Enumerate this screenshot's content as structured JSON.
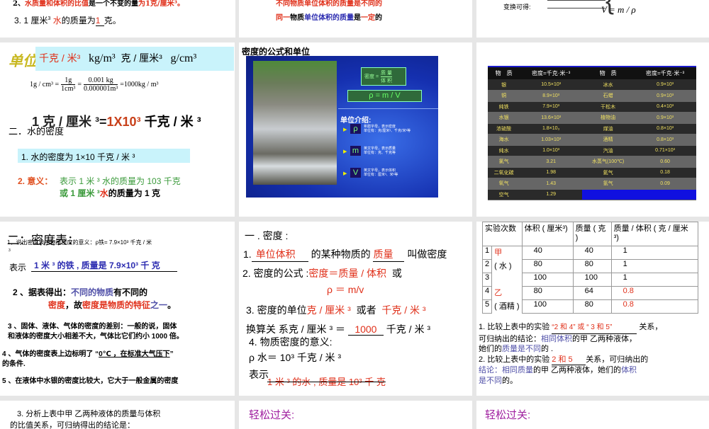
{
  "slide1": {
    "line2_prefix": "2、",
    "line2_red": "水质量和体积的比值",
    "line2_mid": "是一个不变的量",
    "line2_end": "为1克/厘米³。",
    "line3_a": "3. 1 厘米",
    "line3_sup": "3",
    "line3_water": "水",
    "line3_b": "的质量为",
    "line3_blank": "1",
    "line3_c": "克。"
  },
  "slide2": {
    "line1": "不同物质单位体积的质量是不同的",
    "line2_a": "同一",
    "line2_b": "物质",
    "line2_c": "单位体积的质量",
    "line2_d": "是",
    "line2_e": "一定",
    "line2_f": "的"
  },
  "slide3": {
    "label": "变换可得:",
    "formula": "V = m / ρ"
  },
  "slide4": {
    "title": "单位:",
    "u1": "千克 / 米³",
    "u2": "kg/m³",
    "u3": "克 / 厘米³",
    "u4": "g/cm³",
    "conv_lhs": "1g / cm³ =",
    "f1_num": "1g",
    "f1_den": "1cm³",
    "f2_num": "0.001 kg",
    "f2_den": "0.000001m³",
    "conv_rhs": "=1000kg / m³",
    "big_a": "1 克 / 厘米 ³=",
    "big_b": "1X10³",
    "big_c": " 千克 / 米 ³",
    "section": "二．水的密度",
    "item1": "1. 水的密度为 1×10 千克 / 米 ³",
    "item2_label": "2. 意义：",
    "item2_a": "表示 1 米 ³ 水的质量为 103 千克",
    "item2_b_pre": "或 1 厘米 ³",
    "item2_b_water": "水",
    "item2_b_post": "的质量为 1 克"
  },
  "slide5": {
    "title": "密度的公式和单位",
    "formula_word_lhs": "密度 =",
    "formula_word_num": "质 量",
    "formula_word_den": "体 积",
    "formula": "ρ = m / V",
    "units_title": "单位介绍:",
    "units": [
      {
        "sym": "ρ",
        "desc1": "希腊字母，表示密度",
        "desc2": "单位有：克/厘米³、千克/米³等"
      },
      {
        "sym": "m",
        "desc1": "英文字母，表示质量",
        "desc2": "单位有：克、千克等"
      },
      {
        "sym": "V",
        "desc1": "英文字母，表示体积",
        "desc2": "单位有：厘米³、米³等"
      }
    ]
  },
  "slide6": {
    "headers": [
      "物　质",
      "密度=千克·米⁻³",
      "物　质",
      "密度=千克·米⁻³"
    ],
    "rows": [
      [
        "银",
        "10.5×10³",
        "冰水",
        "0.9×10³"
      ],
      [
        "铜",
        "8.9×10³",
        "石蜡",
        "0.9×10³"
      ],
      [
        "纯铁",
        "7.9×10³",
        "干松木",
        "0.4×10³"
      ],
      [
        "水银",
        "13.6×10³",
        "植物油",
        "0.9×10³"
      ],
      [
        "浓硫酸",
        "1.8×10₃",
        "煤油",
        "0.8×10³"
      ],
      [
        "海水",
        "1.03×10³",
        "酒精",
        "0.8×10³"
      ],
      [
        "纯水",
        "1.0×10³",
        "汽油",
        "0.71×10³"
      ],
      [
        "氯气",
        "3.21",
        "水蒸气(100℃)",
        "0.60"
      ],
      [
        "二氧化碳",
        "1.98",
        "氦气",
        "0.18"
      ],
      [
        "氧气",
        "1.43",
        "氢气",
        "0.09"
      ],
      [
        "空气",
        "1.29",
        "",
        ""
      ]
    ]
  },
  "slide7": {
    "title": "二：密度表：",
    "l1": "1、说出密度表中物质密度的意义：ρ铁= 7.9×10³ 千克 / 米",
    "l1_cont": "3",
    "l2_a": "表示",
    "l2_fill": "1 米 ³ 的铁 , 质量是 7.9×10³ 千  克",
    "l3_a": "2 、据表得出：",
    "l3_b": "不同的物质",
    "l3_c": "有不同的",
    "l4_a": "密度",
    "l4_b": "，故",
    "l4_c": "密度是物质的特征",
    "l4_d": "之一",
    "l4_e": "。",
    "l5": "3 、固体、液体、气体的密度的差别：一般的说，固体",
    "l6": "和液体的密度大小相差不大，气体比它们约小 1000 倍。",
    "l7_a": "4 、气体的密度表上边标明了 “",
    "l7_b": "0℃ ，在标准大气压下",
    "l7_c": "”",
    "l8": "的条件.",
    "l9": "5 、在液体中水银的密度比较大，它大于一般金属的密度"
  },
  "slide8": {
    "title": "一 . 密度 :",
    "l1_a": "1.",
    "l1_fill1": "单位体积",
    "l1_b": "的某种物质的",
    "l1_fill2": "质量",
    "l1_c": "叫做密度",
    "l2_a": "2. 密度的公式 :",
    "l2_fill": "密度＝质量 / 体积",
    "l2_b": "或",
    "l2_formula": "ρ ＝ m/v",
    "l3_a": "3. 密度的单位",
    "l3_fill1": "克 / 厘米 ³",
    "l3_b": "或者",
    "l3_fill2": "千克 / 米 ³",
    "l4_a": "换算关  系克 / 厘米 ³ ＝",
    "l4_fill": "1000",
    "l4_b": "千克 / 米 ³",
    "l5": "4. 物质密度的意义:",
    "l6": "ρ 水＝ 10³ 千克 / 米 ³",
    "l7": "表示",
    "l7_fill": "1 米 ³ 的水 , 质量是 10³ 千  克"
  },
  "slide9": {
    "headers": [
      "实验次数",
      "体积 ( 厘米³)",
      "质量 ( 克 )",
      "质量 / 体积 ( 克 / 厘米 ³)"
    ],
    "rows": [
      [
        "1",
        "甲",
        "40",
        "40",
        "1"
      ],
      [
        "2",
        "( 水 )",
        "80",
        "80",
        "1"
      ],
      [
        "3",
        "",
        "100",
        "100",
        "1"
      ],
      [
        "4",
        "乙",
        "80",
        "64",
        "0.8"
      ],
      [
        "5",
        "( 酒精 )",
        "100",
        "80",
        "0.8"
      ]
    ],
    "q1_a": "1. 比较上表中的实验",
    "q1_fill": "“2 和 4” 或 “ 3 和 5”",
    "q1_b": "关系，",
    "q1_c": "可归纳出的结论：",
    "q1_d": "相同体积",
    "q1_e": "的甲  乙两种液体，",
    "q1_f": "她们的",
    "q1_g": "质量是不同",
    "q1_h": "的 .",
    "q2_a": "2. 比较上表中的实验",
    "q2_fill": "2 和 5",
    "q2_b": "关系，可归纳出的",
    "q2_c": "结论：",
    "q2_d": "相同质量",
    "q2_e": "的甲  乙两种液体，她们的",
    "q2_f": "体积",
    "q2_g": "是不同",
    "q2_h": "的。"
  },
  "slide10": {
    "l1": "3. 分析上表中甲  乙两种液体的质量与体积",
    "l2": "的比值关系，可归纳得出的结论是："
  },
  "slide11": {
    "title": "轻松过关:"
  },
  "slide12": {
    "title": "轻松过关:"
  }
}
